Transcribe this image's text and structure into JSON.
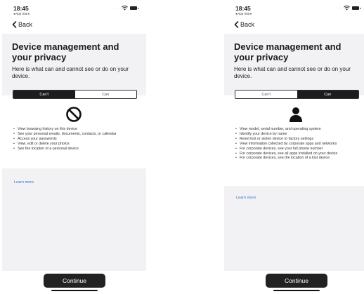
{
  "status": {
    "time": "18:45",
    "back_app": "◂ App Store",
    "signal": "···"
  },
  "nav": {
    "back_label": "Back"
  },
  "header": {
    "title": "Device management and your privacy",
    "subtitle_left": "Here is what          can and cannot see or do on your device.",
    "subtitle_right": "Here is what          can and cannot see or do on your device."
  },
  "segments": {
    "cant": "Can't",
    "can": "Can"
  },
  "left": {
    "selected": "Can't",
    "icon": "prohibited-icon",
    "items": [
      "View browsing history on this device",
      "See your personal emails, documents, contacts, or calendar",
      "Access your passwords",
      "View, edit or delete your photos",
      "See the location of a personal device"
    ]
  },
  "right": {
    "selected": "Can",
    "icon": "person-icon",
    "items": [
      "View model, serial number, and operating system",
      "Identify your device by name",
      "Reset lost or stolen device to factory settings",
      "View information collected by corporate apps and networks",
      "For corporate devices, see your full phone number",
      "For corporate devices, see all apps installed on your device",
      "For corporate devices, see the location of a lost device"
    ]
  },
  "learn_more": "Learn more",
  "continue_label": "Continue",
  "colors": {
    "accent": "#3a6fd0",
    "dark": "#1c1c1c",
    "panel": "#f2f2f4"
  }
}
